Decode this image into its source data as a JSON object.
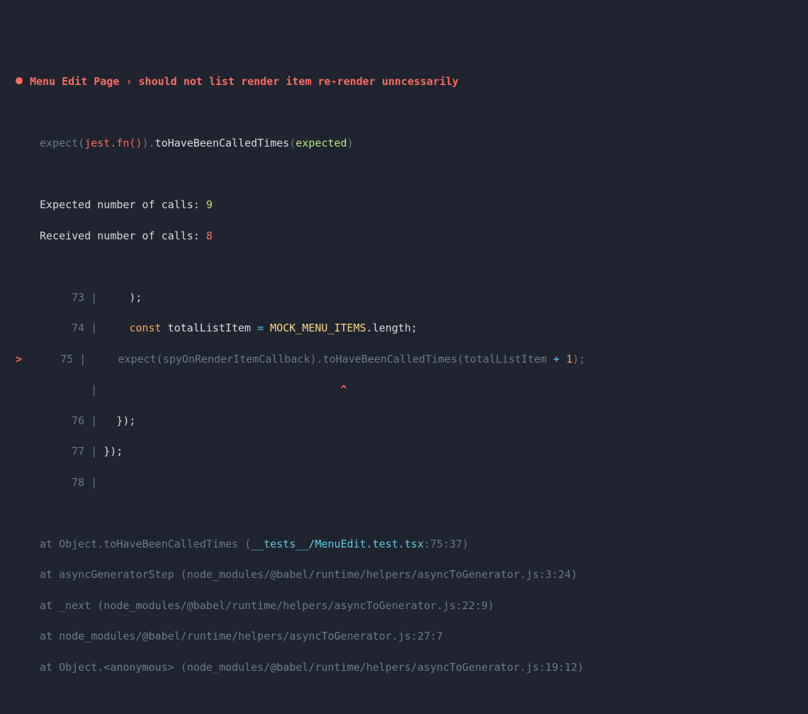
{
  "header": {
    "suite": "Menu Edit Page",
    "sep": "›",
    "test": "should not list render item re-render unncessarily"
  },
  "matcher": {
    "expect": "expect(",
    "jestfn": "jest.fn()",
    "close1": ").",
    "fn": "toHaveBeenCalledTimes",
    "open2": "(",
    "arg": "expected",
    "close2": ")"
  },
  "diff": {
    "expectedLabel": "Expected number of calls: ",
    "expectedVal": "9",
    "receivedLabel": "Received number of calls: ",
    "receivedVal": "8"
  },
  "lines": {
    "l73": {
      "no": "73",
      "code": "    );"
    },
    "l74": {
      "no": "74",
      "kw": "const",
      "var": " totalListItem ",
      "eq": "=",
      "mock": " MOCK_MENU_ITEMS",
      "rest": ".length;"
    },
    "l75": {
      "ptr": ">",
      "no": "75",
      "a": "    expect(spyOnRenderItemCallback).",
      "b": "toHaveBeenCalledTimes",
      "c": "(totalListItem ",
      "plus": "+",
      "num": " 1",
      "d": ");"
    },
    "caretPad": "                                     ",
    "caret": "^",
    "l76": {
      "no": "76",
      "code": "  });"
    },
    "l77": {
      "no": "77",
      "code": "});"
    },
    "l78": {
      "no": "78",
      "code": ""
    }
  },
  "stack": {
    "s1a": "at Object.toHaveBeenCalledTimes (",
    "s1b": "__tests__/MenuEdit.test.tsx",
    "s1c": ":75:37)",
    "s2": "at asyncGeneratorStep (node_modules/@babel/runtime/helpers/asyncToGenerator.js:3:24)",
    "s3": "at _next (node_modules/@babel/runtime/helpers/asyncToGenerator.js:22:9)",
    "s4": "at node_modules/@babel/runtime/helpers/asyncToGenerator.js:27:7",
    "s5": "at Object.<anonymous> (node_modules/@babel/runtime/helpers/asyncToGenerator.js:19:12)"
  }
}
